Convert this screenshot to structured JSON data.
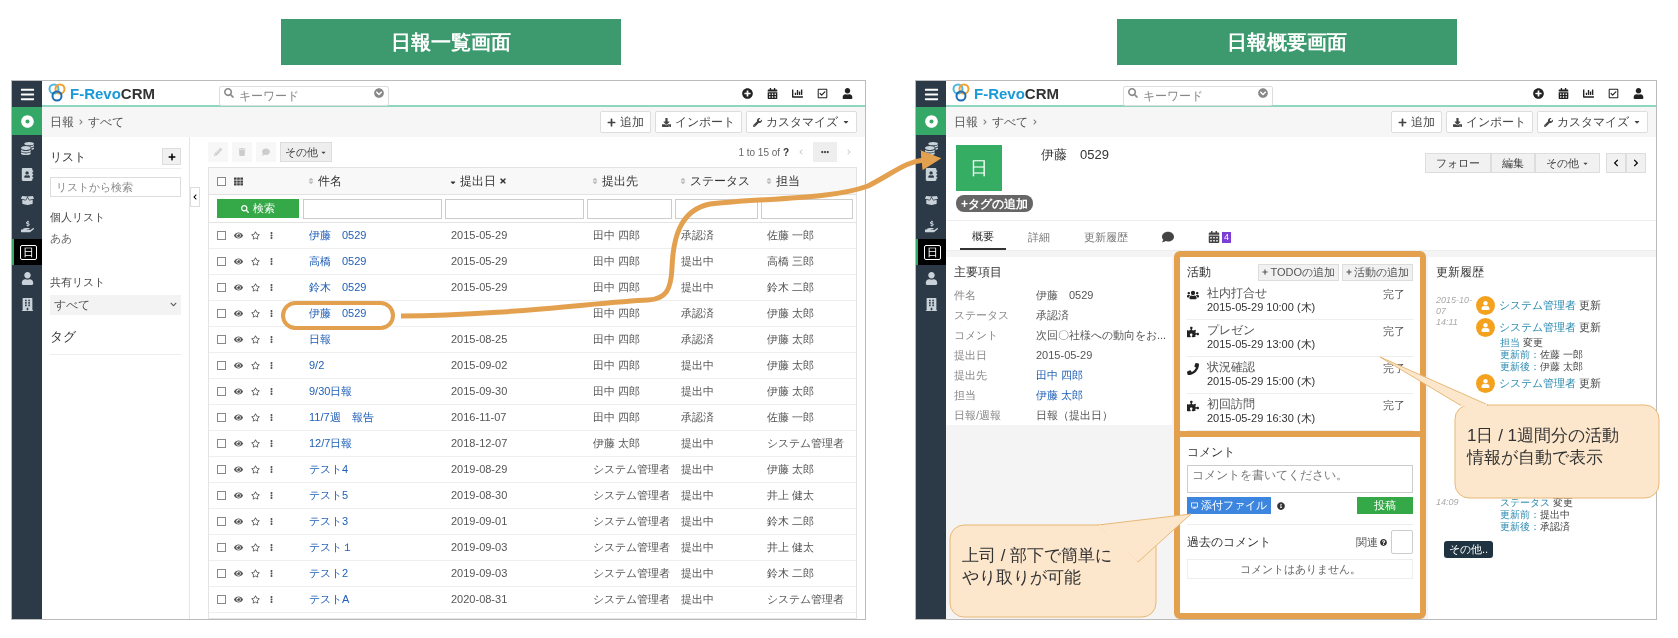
{
  "list_screen": {
    "heading": "日報一覧画面",
    "rail": [
      {
        "kind": "home",
        "selected": false
      },
      {
        "kind": "sales",
        "selected": false
      },
      {
        "kind": "contacts",
        "selected": false
      },
      {
        "kind": "inventory",
        "selected": false
      },
      {
        "kind": "support",
        "selected": false
      },
      {
        "kind": "daily",
        "icon_text": "日",
        "selected": true
      },
      {
        "kind": "people",
        "selected": false
      },
      {
        "kind": "org",
        "selected": false
      }
    ],
    "logo": {
      "part_1": "F-Revo",
      "part_2": "CRM"
    },
    "search_placeholder": "キーワード",
    "breadcrumb": [
      "日報",
      "すべて"
    ],
    "actions": [
      {
        "kind": "add",
        "label": "追加"
      },
      {
        "kind": "import",
        "label": "インポート"
      },
      {
        "kind": "customize",
        "label": "カスタマイズ"
      }
    ],
    "sidebar": {
      "title": "リスト",
      "search_placeholder": "リストから検索",
      "personal_title": "個人リスト",
      "personal_items": [
        "ああ"
      ],
      "shared_title": "共有リスト",
      "shared_select": "すべて",
      "tags_title": "タグ"
    },
    "more_button": "その他",
    "pagination": {
      "range": "1 to 15 of",
      "total": "?"
    },
    "search_button": "検索",
    "select_all_checked": false,
    "columns": [
      {
        "label": "件名",
        "sorted": false,
        "removable": false
      },
      {
        "label": "提出日",
        "sorted": true,
        "removable": true
      },
      {
        "label": "提出先",
        "sorted": false,
        "removable": false
      },
      {
        "label": "ステータス",
        "sorted": false,
        "removable": false
      },
      {
        "label": "担当",
        "sorted": false,
        "removable": false
      }
    ],
    "rows": [
      {
        "subject": "伊藤　0529",
        "date": "2015-05-29",
        "to": "田中 四郎",
        "status": "承認済",
        "owner": "佐藤 一郎",
        "checked": false,
        "circled": false
      },
      {
        "subject": "高橋　0529",
        "date": "2015-05-29",
        "to": "田中 四郎",
        "status": "提出中",
        "owner": "高橋 三郎",
        "checked": false,
        "circled": false
      },
      {
        "subject": "鈴木　0529",
        "date": "2015-05-29",
        "to": "田中 四郎",
        "status": "提出中",
        "owner": "鈴木 二郎",
        "checked": false,
        "circled": false
      },
      {
        "subject": "伊藤　0529",
        "to": "田中 四郎",
        "status": "承認済",
        "owner": "伊藤 太郎",
        "checked": false,
        "circled": true
      },
      {
        "subject": "日報",
        "date": "2015-08-25",
        "to": "田中 四郎",
        "status": "承認済",
        "owner": "伊藤 太郎",
        "checked": false,
        "circled": false
      },
      {
        "subject": "9/2",
        "date": "2015-09-02",
        "to": "田中 四郎",
        "status": "提出中",
        "owner": "伊藤 太郎",
        "checked": false,
        "circled": false
      },
      {
        "subject": "9/30日報",
        "date": "2015-09-30",
        "to": "田中 四郎",
        "status": "提出中",
        "owner": "伊藤 太郎",
        "checked": false,
        "circled": false
      },
      {
        "subject": "11/7週　報告",
        "date": "2016-11-07",
        "to": "田中 四郎",
        "status": "承認済",
        "owner": "佐藤 一郎",
        "checked": false,
        "circled": false
      },
      {
        "subject": "12/7日報",
        "date": "2018-12-07",
        "to": "伊藤 太郎",
        "status": "提出中",
        "owner": "システム管理者",
        "checked": false,
        "circled": false
      },
      {
        "subject": "テスト4",
        "date": "2019-08-29",
        "to": "システム管理者",
        "status": "提出中",
        "owner": "伊藤 太郎",
        "checked": false,
        "circled": false
      },
      {
        "subject": "テスト5",
        "date": "2019-08-30",
        "to": "システム管理者",
        "status": "提出中",
        "owner": "井上 健太",
        "checked": false,
        "circled": false
      },
      {
        "subject": "テスト3",
        "date": "2019-09-01",
        "to": "システム管理者",
        "status": "提出中",
        "owner": "鈴木 二郎",
        "checked": false,
        "circled": false
      },
      {
        "subject": "テスト１",
        "date": "2019-09-03",
        "to": "システム管理者",
        "status": "提出中",
        "owner": "井上 健太",
        "checked": false,
        "circled": false
      },
      {
        "subject": "テスト2",
        "date": "2019-09-03",
        "to": "システム管理者",
        "status": "提出中",
        "owner": "鈴木 二郎",
        "checked": false,
        "circled": false
      },
      {
        "subject": "テストA",
        "date": "2020-08-31",
        "to": "システム管理者",
        "status": "提出中",
        "owner": "システム管理者",
        "checked": false,
        "circled": false
      }
    ]
  },
  "detail_screen": {
    "heading": "日報概要画面",
    "rail": [
      {
        "kind": "home",
        "selected": false
      },
      {
        "kind": "sales",
        "selected": false
      },
      {
        "kind": "contacts",
        "selected": false
      },
      {
        "kind": "inventory",
        "selected": false
      },
      {
        "kind": "support",
        "selected": false
      },
      {
        "kind": "daily",
        "icon_text": "日",
        "selected": true
      },
      {
        "kind": "people",
        "selected": false
      },
      {
        "kind": "org",
        "selected": false
      }
    ],
    "logo": {
      "part_1": "F-Revo",
      "part_2": "CRM"
    },
    "search_placeholder": "キーワード",
    "breadcrumb": [
      "日報",
      "すべて"
    ],
    "actions": [
      {
        "kind": "add",
        "label": "追加"
      },
      {
        "kind": "import",
        "label": "インポート"
      },
      {
        "kind": "customize",
        "label": "カスタマイズ"
      }
    ],
    "record": {
      "icon_text": "日",
      "title": "伊藤　0529",
      "tag_button": "+タグの追加"
    },
    "record_buttons": [
      {
        "kind": "text",
        "label": "フォロー"
      },
      {
        "kind": "text",
        "label": "編集"
      },
      {
        "kind": "menu",
        "label": "その他"
      },
      {
        "kind": "prev"
      },
      {
        "kind": "next"
      }
    ],
    "tabs": [
      {
        "kind": "text",
        "label": "概要",
        "selected": true
      },
      {
        "kind": "text",
        "label": "詳細",
        "selected": false
      },
      {
        "kind": "text",
        "label": "更新履歴",
        "selected": false
      },
      {
        "kind": "comments",
        "selected": false
      },
      {
        "kind": "activities",
        "badge": "4",
        "selected": false
      }
    ],
    "summary": {
      "title": "主要項目",
      "fields": [
        {
          "label": "件名",
          "value": "伊藤　0529",
          "link": false
        },
        {
          "label": "ステータス",
          "value": "承認済",
          "link": false
        },
        {
          "label": "コメント",
          "value": "次回〇社様への動向をお...",
          "link": false
        },
        {
          "label": "提出日",
          "value": "2015-05-29",
          "link": false
        },
        {
          "label": "提出先",
          "value": "田中 四郎",
          "link": true
        },
        {
          "label": "担当",
          "value": "伊藤 太郎",
          "link": true
        },
        {
          "label": "日報/週報",
          "value": "日報（提出日）",
          "link": false
        }
      ]
    },
    "activities": {
      "title": "活動",
      "buttons": [
        "TODOの追加",
        "活動の追加"
      ],
      "items": [
        {
          "kind": "meeting",
          "title": "社内打合せ",
          "time": "2015-05-29 10:00 (木)",
          "status": "完了"
        },
        {
          "kind": "task",
          "title": "プレゼン",
          "time": "2015-05-29 13:00 (木)",
          "status": "完了"
        },
        {
          "kind": "call",
          "title": "状況確認",
          "time": "2015-05-29 15:00 (木)",
          "status": "完了"
        },
        {
          "kind": "task",
          "title": "初回訪問",
          "time": "2015-05-29 16:30 (木)",
          "status": "完了"
        }
      ]
    },
    "comments": {
      "title": "コメント",
      "placeholder": "コメントを書いてください。",
      "attach_button": "添付ファイル",
      "post_button": "投稿",
      "past_title": "過去のコメント",
      "related": {
        "label": "関連",
        "on": false
      },
      "empty": "コメントはありません。"
    },
    "history": {
      "title": "更新履歴",
      "entries": [
        {
          "date": "2015-10-07",
          "user": "システム管理者",
          "action": "更新"
        },
        {
          "date": "14:11",
          "user": "システム管理者",
          "action": "更新",
          "changes": [
            {
              "field": "担当",
              "verb": "変更",
              "before_label": "更新前：",
              "before": "佐藤 一郎",
              "after_label": "更新後：",
              "after": "伊藤 太郎"
            }
          ]
        },
        {
          "user": "システム管理者",
          "action": "更新"
        },
        {
          "date": "14:09",
          "changes": [
            {
              "field": "ステータス",
              "verb": "変更",
              "before_label": "更新前：",
              "before": "提出中",
              "after_label": "更新後：",
              "after": "承認済"
            }
          ]
        }
      ],
      "more_button": "その他.."
    }
  },
  "callouts": [
    {
      "lines": [
        "1日 / 1週間分の活動",
        "情報が自動で表示"
      ]
    },
    {
      "lines": [
        "上司 / 部下で簡単に",
        "やり取りが可能"
      ]
    }
  ]
}
